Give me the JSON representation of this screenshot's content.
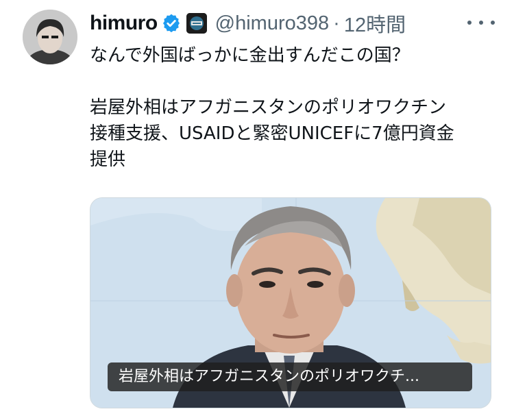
{
  "author": {
    "display_name": "himuro",
    "handle": "@himuro398",
    "separator": "·",
    "time": "12時間",
    "verified_icon": "verified-badge-icon",
    "affiliate_icon": "affiliate-badge-icon",
    "avatar_icon": "profile-avatar"
  },
  "tweet": {
    "line1": "なんで外国ばっかに金出すんだこの国？",
    "line2": "岩屋外相はアフガニスタンのポリオワクチン",
    "line3": "接種支援、USAIDと緊密UNICEFに7億円資金",
    "line4": "提供"
  },
  "media": {
    "caption": "岩屋外相はアフガニスタンのポリオワクチ..."
  },
  "menu": {
    "more_icon": "more-options-icon"
  },
  "colors": {
    "verified": "#1d9bf0",
    "secondary_text": "#536471",
    "primary_text": "#0f1419",
    "border": "#cfd9de"
  }
}
